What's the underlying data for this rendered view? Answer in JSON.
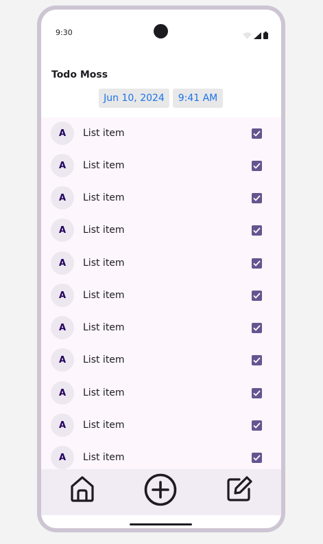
{
  "status_bar": {
    "time": "9:30",
    "icons": [
      "wifi-icon",
      "signal-icon",
      "battery-icon"
    ]
  },
  "app": {
    "title": "Todo Moss",
    "date": "Jun 10, 2024",
    "time": "9:41 AM"
  },
  "list": {
    "items": [
      {
        "avatar": "A",
        "label": "List item",
        "checked": true
      },
      {
        "avatar": "A",
        "label": "List item",
        "checked": true
      },
      {
        "avatar": "A",
        "label": "List item",
        "checked": true
      },
      {
        "avatar": "A",
        "label": "List item",
        "checked": true
      },
      {
        "avatar": "A",
        "label": "List item",
        "checked": true
      },
      {
        "avatar": "A",
        "label": "List item",
        "checked": true
      },
      {
        "avatar": "A",
        "label": "List item",
        "checked": true
      },
      {
        "avatar": "A",
        "label": "List item",
        "checked": true
      },
      {
        "avatar": "A",
        "label": "List item",
        "checked": true
      },
      {
        "avatar": "A",
        "label": "List item",
        "checked": true
      },
      {
        "avatar": "A",
        "label": "List item",
        "checked": true
      }
    ]
  },
  "bottom_nav": {
    "items": [
      "home-icon",
      "add-circle-icon",
      "edit-icon"
    ]
  },
  "colors": {
    "accent": "#65558f",
    "link": "#1a73e8",
    "list_bg": "#fdf6fd",
    "nav_bg": "#f1ebf4",
    "frame": "#cdc5d3"
  }
}
